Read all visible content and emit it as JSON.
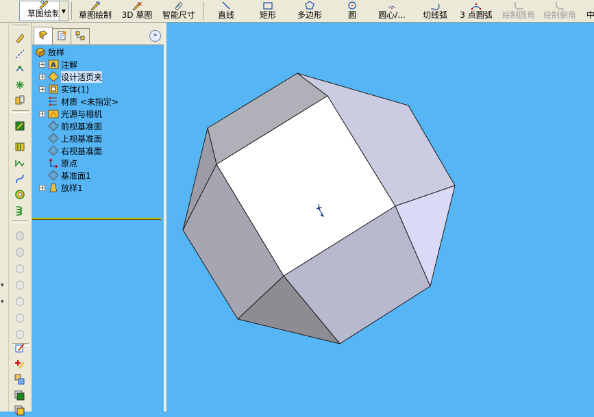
{
  "toolbar": {
    "sketch_main": "草图绘制",
    "items": [
      {
        "name": "sketch-button",
        "label": "草图绘制",
        "icon": "sketch-pencil-icon"
      },
      {
        "name": "3d-sketch-button",
        "label": "3D 草图",
        "icon": "3d-sketch-icon"
      },
      {
        "name": "smart-dimension-button",
        "label": "智能尺寸",
        "icon": "smart-dimension-icon"
      },
      {
        "name": "line-button",
        "label": "直线",
        "icon": "line-icon"
      },
      {
        "name": "rectangle-button",
        "label": "矩形",
        "icon": "rectangle-icon"
      },
      {
        "name": "polygon-button",
        "label": "多边形",
        "icon": "polygon-icon"
      },
      {
        "name": "circle-button",
        "label": "圆",
        "icon": "circle-icon"
      },
      {
        "name": "centerpoint-arc-button",
        "label": "圆心/...",
        "icon": "centerpoint-arc-icon"
      },
      {
        "name": "tangent-arc-button",
        "label": "切线弧",
        "icon": "tangent-arc-icon"
      },
      {
        "name": "3point-arc-button",
        "label": "3 点圆弧",
        "icon": "3point-arc-icon"
      },
      {
        "name": "sketch-fillet-button",
        "label": "绘制圆角",
        "icon": "sketch-fillet-icon"
      },
      {
        "name": "sketch-chamfer-button",
        "label": "绘制倒角",
        "icon": "sketch-chamfer-icon"
      },
      {
        "name": "centerline-button",
        "label": "中",
        "icon": "centerline-icon"
      }
    ]
  },
  "feature_manager": {
    "expand_glyph": "»",
    "tree": [
      {
        "label": "放样",
        "icon": "part-icon",
        "expander": ""
      },
      {
        "label": "注解",
        "icon": "annotations-icon",
        "expander": "+"
      },
      {
        "label": "设计活页夹",
        "icon": "design-binder-icon",
        "expander": "+"
      },
      {
        "label": "实体(1)",
        "icon": "solid-bodies-icon",
        "expander": "+"
      },
      {
        "label": "材质 <未指定>",
        "icon": "material-icon",
        "expander": ""
      },
      {
        "label": "光源与相机",
        "icon": "lights-cameras-icon",
        "expander": "+"
      },
      {
        "label": "前视基准面",
        "icon": "plane-icon",
        "expander": ""
      },
      {
        "label": "上视基准面",
        "icon": "plane-icon",
        "expander": ""
      },
      {
        "label": "右视基准面",
        "icon": "plane-icon",
        "expander": ""
      },
      {
        "label": "原点",
        "icon": "origin-icon",
        "expander": ""
      },
      {
        "label": "基准面1",
        "icon": "plane-icon",
        "expander": ""
      },
      {
        "label": "放样1",
        "icon": "loft-feature-icon",
        "expander": "+"
      }
    ]
  },
  "left_strip_icons": [
    "smart-dimension-icon",
    "centerline-icon",
    "point-icon",
    "sketch-point-icon",
    "extrude-icon",
    "sketch-icon",
    "wall-icon",
    "curve-icon",
    "spline-icon",
    "hole-icon",
    "helix-icon",
    "cube-icon",
    "cube-icon",
    "cube-icon",
    "cube-icon",
    "cube-icon",
    "cube-icon",
    "cube-icon",
    "edit-icon",
    "add-icon",
    "move-icon",
    "copy-icon",
    "copy-icon"
  ],
  "colors": {
    "background": "#56b5f5",
    "panel": "#ece9d8",
    "rollback_bar": "#c8b900"
  }
}
